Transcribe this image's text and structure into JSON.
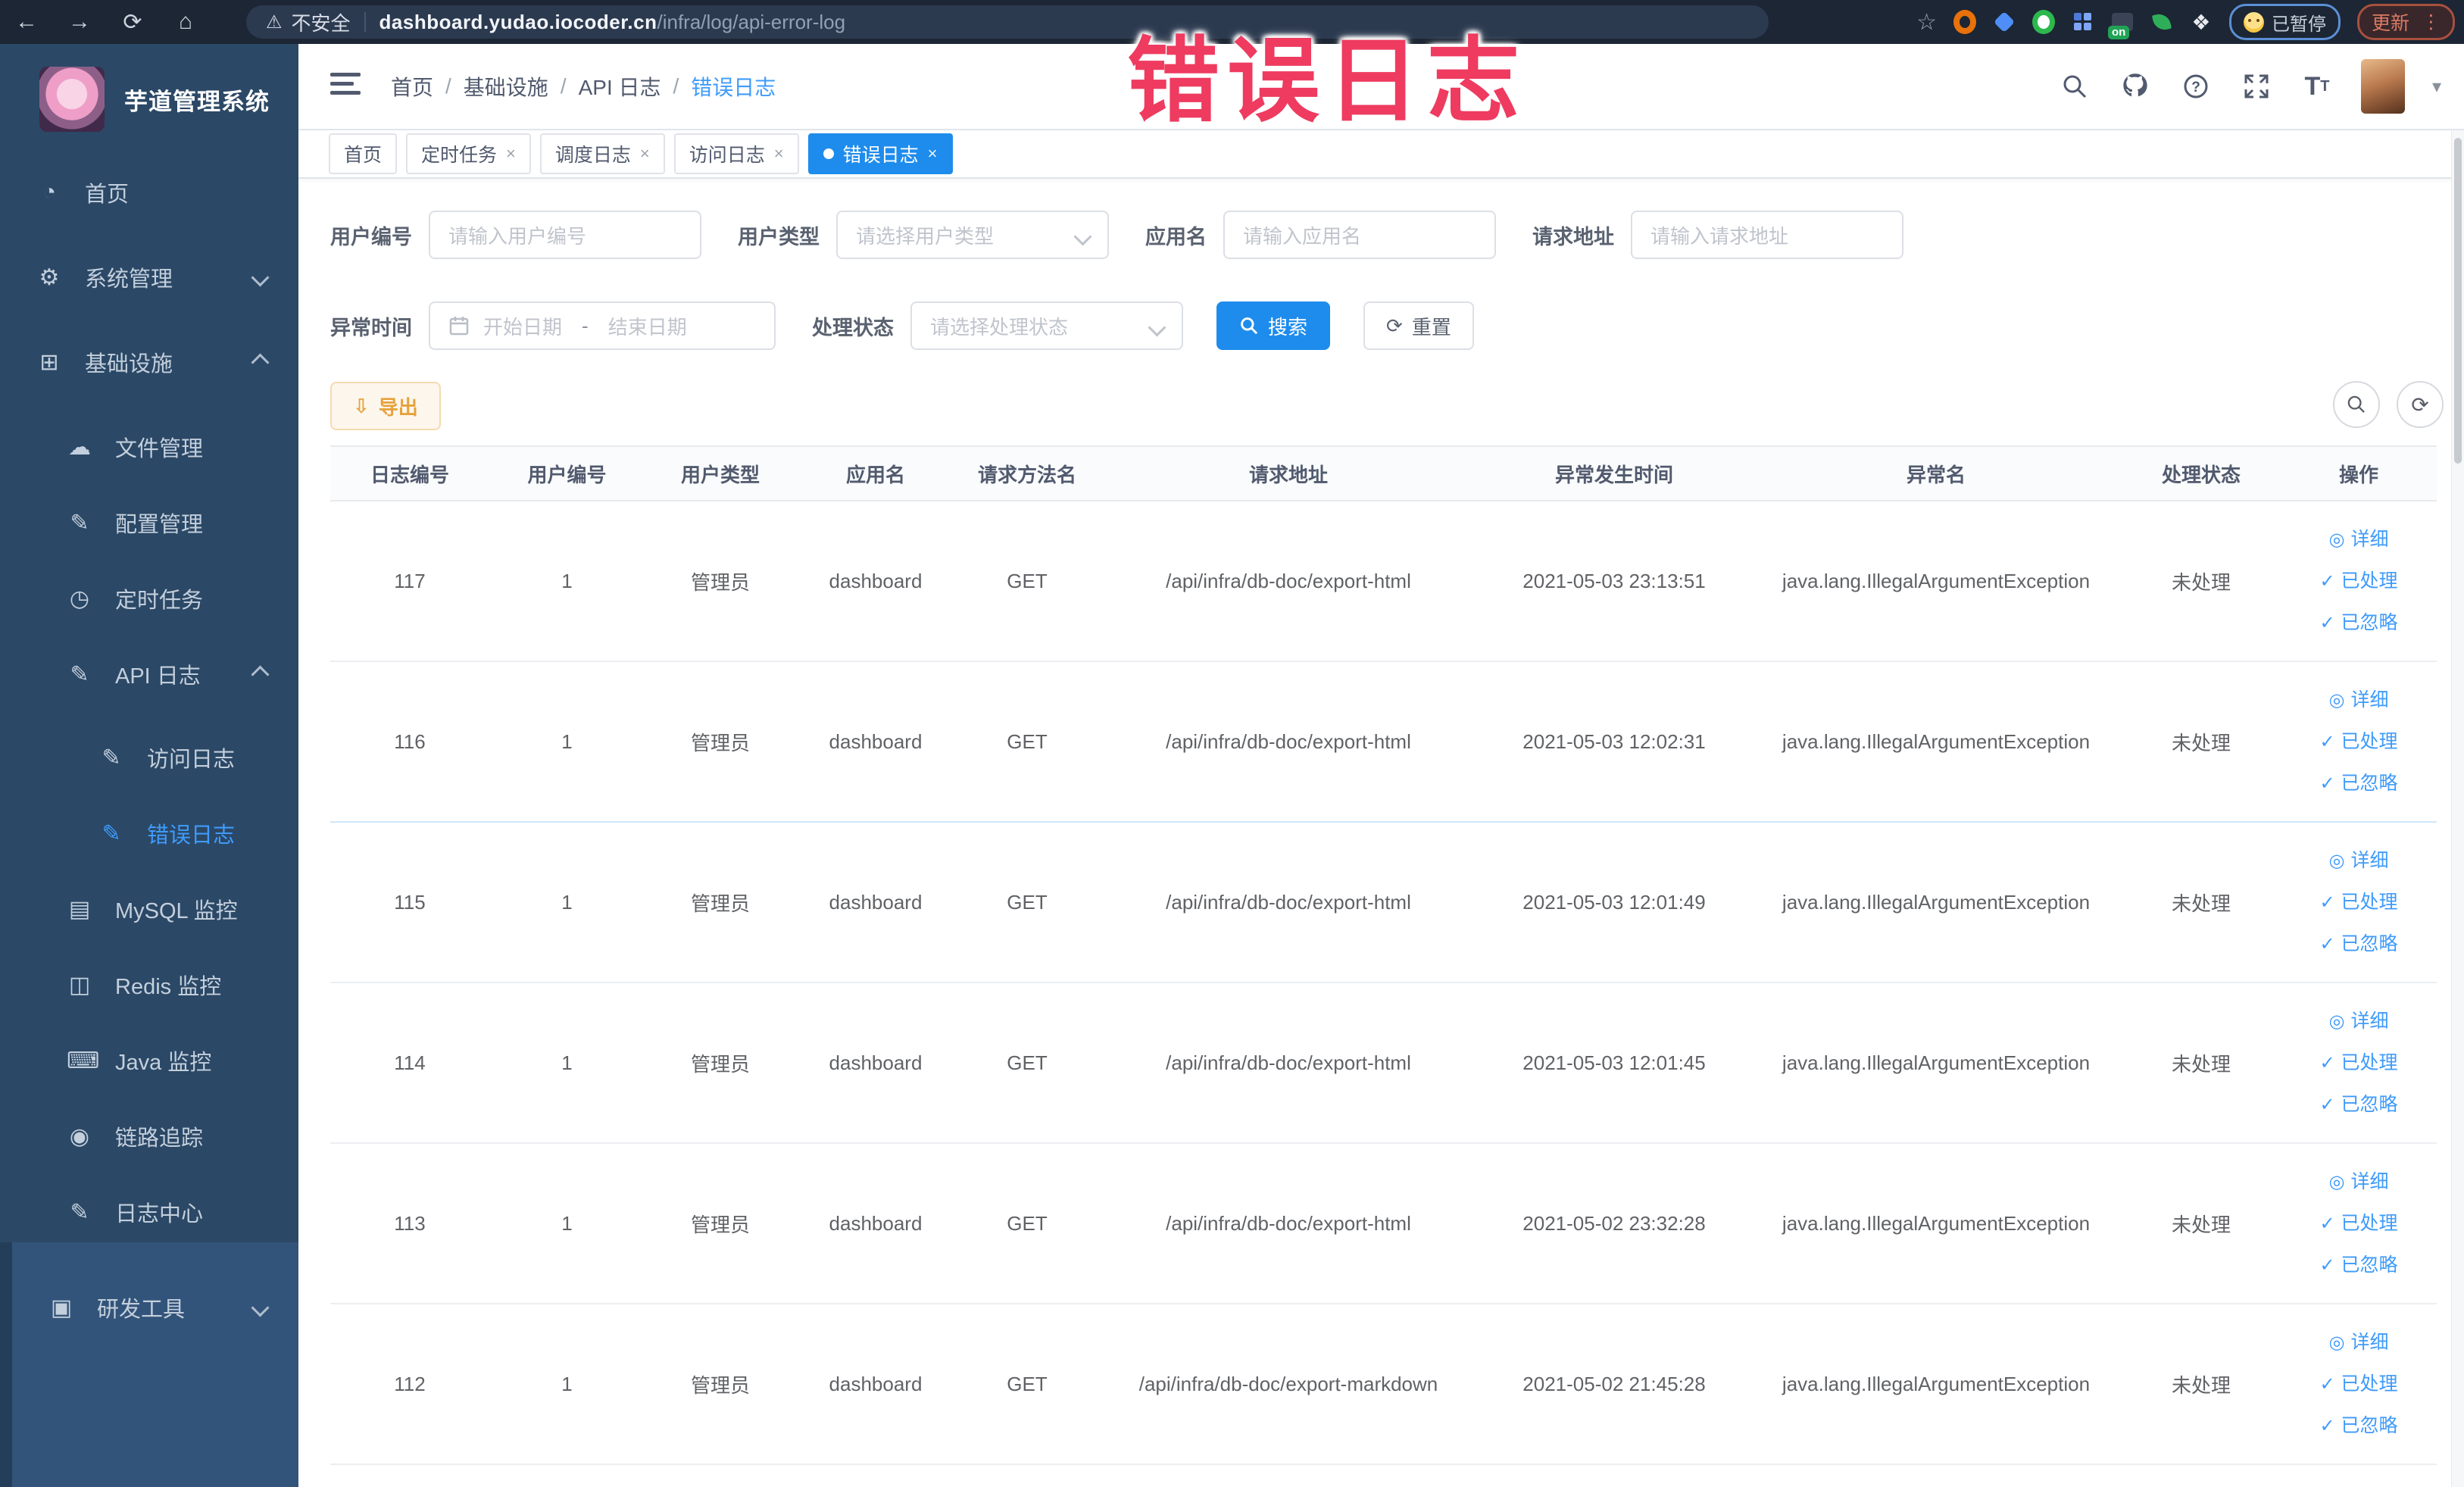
{
  "colors": {
    "accent": "#1e8cec",
    "link": "#3f9bfa",
    "warning": "#e6a23c",
    "overlay_red": "#ee3b5f",
    "tab_active": "#1e8cec"
  },
  "browser": {
    "security_label": "不安全",
    "url_host": "dashboard.yudao.iocoder.cn",
    "url_path": "/infra/log/api-error-log",
    "on_badge": "on",
    "profile_chip": "已暂停",
    "update_button": "更新"
  },
  "overlay": {
    "title": "错误日志"
  },
  "sidebar": {
    "logo_title": "芋道管理系统",
    "items": [
      {
        "key": "home",
        "label": "首页",
        "icon": "dashboard-icon",
        "glyph": "◔",
        "level": 1
      },
      {
        "key": "system",
        "label": "系统管理",
        "icon": "gear-icon",
        "glyph": "⚙",
        "level": 1,
        "chevron": "down"
      },
      {
        "key": "infra",
        "label": "基础设施",
        "icon": "infra-icon",
        "glyph": "⊞",
        "level": 1,
        "chevron": "up"
      },
      {
        "key": "file",
        "label": "文件管理",
        "icon": "cloud-icon",
        "glyph": "☁",
        "level": 2
      },
      {
        "key": "config",
        "label": "配置管理",
        "icon": "edit-icon",
        "glyph": "✎",
        "level": 2
      },
      {
        "key": "job",
        "label": "定时任务",
        "icon": "timer-icon",
        "glyph": "◷",
        "level": 2
      },
      {
        "key": "api-log",
        "label": "API 日志",
        "icon": "log-icon",
        "glyph": "✎",
        "level": 2,
        "chevron": "up"
      },
      {
        "key": "access-log",
        "label": "访问日志",
        "icon": "log-icon",
        "glyph": "✎",
        "level": 3
      },
      {
        "key": "error-log",
        "label": "错误日志",
        "icon": "log-icon",
        "glyph": "✎",
        "level": 3,
        "active": true
      },
      {
        "key": "mysql",
        "label": "MySQL 监控",
        "icon": "database-icon",
        "glyph": "▤",
        "level": 2
      },
      {
        "key": "redis",
        "label": "Redis 监控",
        "icon": "layers-icon",
        "glyph": "◫",
        "level": 2
      },
      {
        "key": "java",
        "label": "Java 监控",
        "icon": "monitor-icon",
        "glyph": "⌨",
        "level": 2
      },
      {
        "key": "trace",
        "label": "链路追踪",
        "icon": "eye-icon",
        "glyph": "◉",
        "level": 2
      },
      {
        "key": "log-center",
        "label": "日志中心",
        "icon": "log-icon",
        "glyph": "✎",
        "level": 2
      }
    ],
    "bottom_item": {
      "key": "devtools",
      "label": "研发工具",
      "icon": "toolbox-icon",
      "glyph": "▣",
      "chevron": "down"
    }
  },
  "header": {
    "breadcrumb": [
      "首页",
      "基础设施",
      "API 日志",
      "错误日志"
    ]
  },
  "tabs": [
    {
      "label": "首页",
      "closable": false,
      "active": false
    },
    {
      "label": "定时任务",
      "closable": true,
      "active": false
    },
    {
      "label": "调度日志",
      "closable": true,
      "active": false
    },
    {
      "label": "访问日志",
      "closable": true,
      "active": false
    },
    {
      "label": "错误日志",
      "closable": true,
      "active": true
    }
  ],
  "filters": {
    "row1": [
      {
        "key": "user-id",
        "label": "用户编号",
        "placeholder": "请输入用户编号",
        "type": "input"
      },
      {
        "key": "user-type",
        "label": "用户类型",
        "placeholder": "请选择用户类型",
        "type": "select"
      },
      {
        "key": "app-name",
        "label": "应用名",
        "placeholder": "请输入应用名",
        "type": "input"
      },
      {
        "key": "request-url",
        "label": "请求地址",
        "placeholder": "请输入请求地址",
        "type": "input"
      }
    ],
    "time_label": "异常时间",
    "date_start_placeholder": "开始日期",
    "date_separator": "-",
    "date_end_placeholder": "结束日期",
    "status_label": "处理状态",
    "status_placeholder": "请选择处理状态",
    "search_button": "搜索",
    "reset_button": "重置"
  },
  "toolbar": {
    "export_button": "导出"
  },
  "table": {
    "headers": [
      "日志编号",
      "用户编号",
      "用户类型",
      "应用名",
      "请求方法名",
      "请求地址",
      "异常发生时间",
      "异常名",
      "处理状态",
      "操作"
    ],
    "ops": [
      "详细",
      "已处理",
      "已忽略"
    ],
    "rows": [
      {
        "id": "117",
        "user_id": "1",
        "user_type": "管理员",
        "app": "dashboard",
        "method": "GET",
        "url": "/api/infra/db-doc/export-html",
        "time": "2021-05-03 23:13:51",
        "exception": "java.lang.IllegalArgumentException",
        "status": "未处理",
        "divider": "gray"
      },
      {
        "id": "116",
        "user_id": "1",
        "user_type": "管理员",
        "app": "dashboard",
        "method": "GET",
        "url": "/api/infra/db-doc/export-html",
        "time": "2021-05-03 12:02:31",
        "exception": "java.lang.IllegalArgumentException",
        "status": "未处理",
        "divider": "blue"
      },
      {
        "id": "115",
        "user_id": "1",
        "user_type": "管理员",
        "app": "dashboard",
        "method": "GET",
        "url": "/api/infra/db-doc/export-html",
        "time": "2021-05-03 12:01:49",
        "exception": "java.lang.IllegalArgumentException",
        "status": "未处理",
        "divider": "gray"
      },
      {
        "id": "114",
        "user_id": "1",
        "user_type": "管理员",
        "app": "dashboard",
        "method": "GET",
        "url": "/api/infra/db-doc/export-html",
        "time": "2021-05-03 12:01:45",
        "exception": "java.lang.IllegalArgumentException",
        "status": "未处理",
        "divider": "gray"
      },
      {
        "id": "113",
        "user_id": "1",
        "user_type": "管理员",
        "app": "dashboard",
        "method": "GET",
        "url": "/api/infra/db-doc/export-html",
        "time": "2021-05-02 23:32:28",
        "exception": "java.lang.IllegalArgumentException",
        "status": "未处理",
        "divider": "gray"
      },
      {
        "id": "112",
        "user_id": "1",
        "user_type": "管理员",
        "app": "dashboard",
        "method": "GET",
        "url": "/api/infra/db-doc/export-markdown",
        "time": "2021-05-02 21:45:28",
        "exception": "java.lang.IllegalArgumentException",
        "status": "未处理",
        "divider": "gray"
      }
    ]
  }
}
